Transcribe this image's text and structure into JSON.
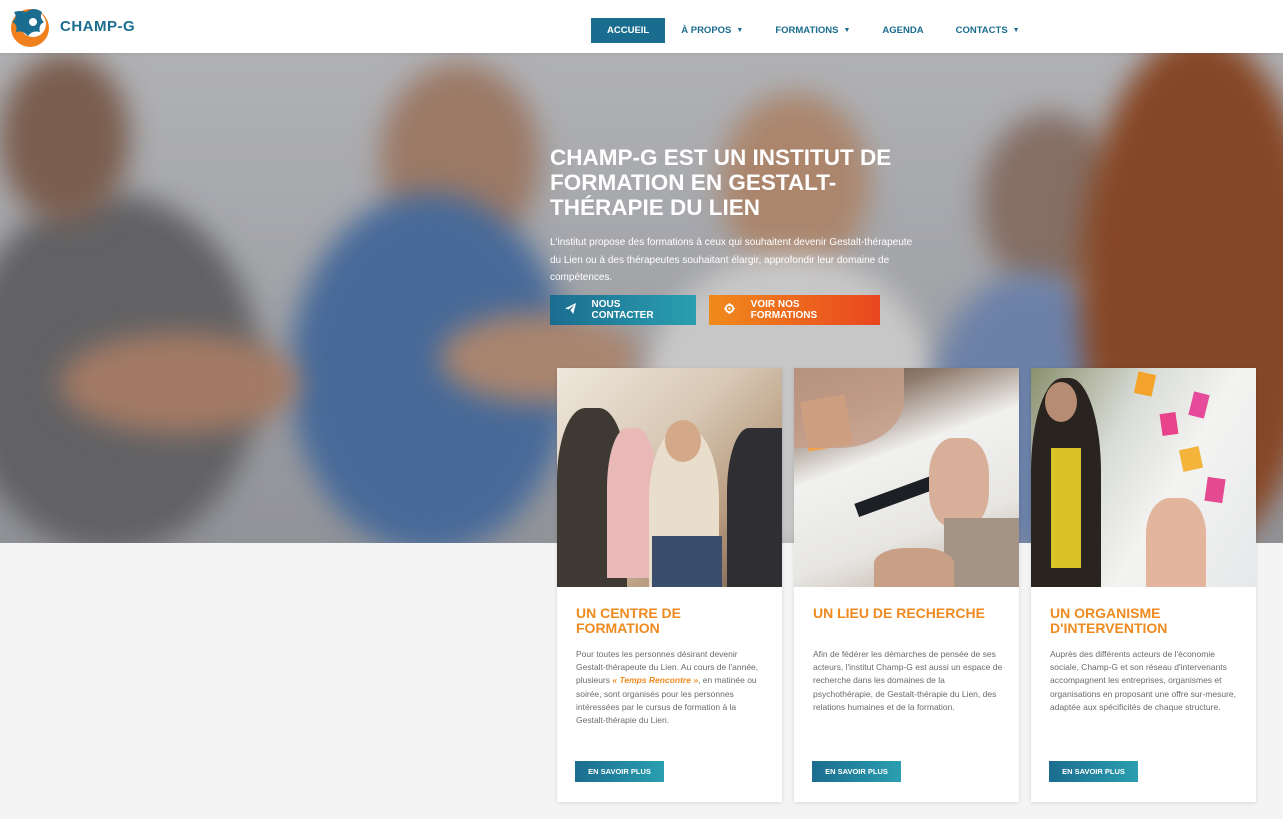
{
  "brand": {
    "name": "CHAMP-G"
  },
  "nav": {
    "items": [
      {
        "label": "ACCUEIL",
        "has_caret": false,
        "active": true
      },
      {
        "label": "À PROPOS",
        "has_caret": true,
        "active": false
      },
      {
        "label": "FORMATIONS",
        "has_caret": true,
        "active": false
      },
      {
        "label": "AGENDA",
        "has_caret": false,
        "active": false
      },
      {
        "label": "CONTACTS",
        "has_caret": true,
        "active": false
      }
    ],
    "caret_icon": "caret-down-icon"
  },
  "hero": {
    "title": "CHAMP-G EST UN INSTITUT DE FORMATION EN GESTALT-THÉRAPIE DU LIEN",
    "text": "L'institut propose des formations à ceux qui souhaitent devenir Gestalt-thérapeute du Lien ou à des thérapeutes souhaitant élargir, approfondir leur domaine de compétences.",
    "buttons": [
      {
        "label": "NOUS CONTACTER",
        "icon": "paper-plane-icon"
      },
      {
        "label": "VOIR NOS FORMATIONS",
        "icon": "gear-icon"
      }
    ]
  },
  "cards": [
    {
      "title": "UN CENTRE DE FORMATION",
      "text_before": "Pour toutes les personnes désirant devenir Gestalt-thérapeute du Lien. Au cours de l'année, plusieurs ",
      "highlight": "« Temps Rencontre »",
      "text_after": ", en matinée ou soirée, sont organisés pour les personnes intéressées par le cursus de formation à la Gestalt-thérapie du Lien.",
      "button": "EN SAVOIR PLUS"
    },
    {
      "title": "UN LIEU DE RECHERCHE",
      "text": "Afin de fédérer les démarches de pensée de ses acteurs, l'institut Champ-G est aussi un espace de recherche dans les domaines de la psychothérapie, de Gestalt-thérapie du Lien, des relations humaines et de la formation.",
      "button": "EN SAVOIR PLUS"
    },
    {
      "title": "UN ORGANISME D'INTERVENTION",
      "text": "Auprès des différents acteurs de l'économie sociale, Champ-G et son réseau d'intervenants accompagnent les entreprises, organismes et organisations en proposant une offre sur-mesure, adaptée aux spécificités de chaque structure.",
      "button": "EN SAVOIR PLUS"
    }
  ],
  "colors": {
    "primary": "#1b6d8f",
    "accent_orange": "#ef8a1f",
    "accent_red": "#e9461f",
    "background": "#f4f4f4"
  }
}
